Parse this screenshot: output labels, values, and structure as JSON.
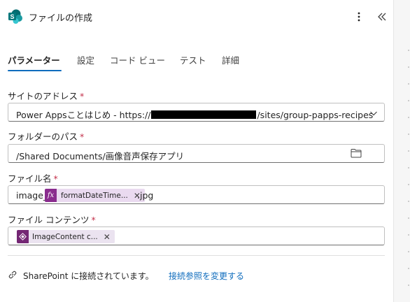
{
  "header": {
    "title": "ファイルの作成",
    "logo_icon": "sharepoint-icon",
    "more_icon": "more-vertical-icon",
    "collapse_icon": "double-chevron-left-icon"
  },
  "tabs": [
    {
      "label": "パラメーター",
      "active": true
    },
    {
      "label": "設定",
      "active": false
    },
    {
      "label": "コード ビュー",
      "active": false
    },
    {
      "label": "テスト",
      "active": false
    },
    {
      "label": "詳細",
      "active": false
    }
  ],
  "fields": {
    "site": {
      "label": "サイトのアドレス",
      "required": "*",
      "value_prefix": "Power Appsことはじめ - https://",
      "value_suffix": "/sites/group-papps-recipes"
    },
    "folder": {
      "label": "フォルダーのパス",
      "required": "*",
      "value": "/Shared Documents/画像音声保存アプリ"
    },
    "filename": {
      "label": "ファイル名",
      "required": "*",
      "prefix": "image_",
      "token_icon": "fx",
      "token_label": "formatDateTime...",
      "suffix": ".jpg"
    },
    "content": {
      "label": "ファイル コンテンツ",
      "required": "*",
      "token_label": "ImageContent c..."
    }
  },
  "connection": {
    "status": "SharePoint に接続されています。",
    "change_link": "接続参照を変更する"
  },
  "colors": {
    "accent": "#0f6cbd",
    "token_bg": "#eadaf0",
    "token_icon_bg": "#8a2c8e",
    "required": "#c4314b"
  }
}
